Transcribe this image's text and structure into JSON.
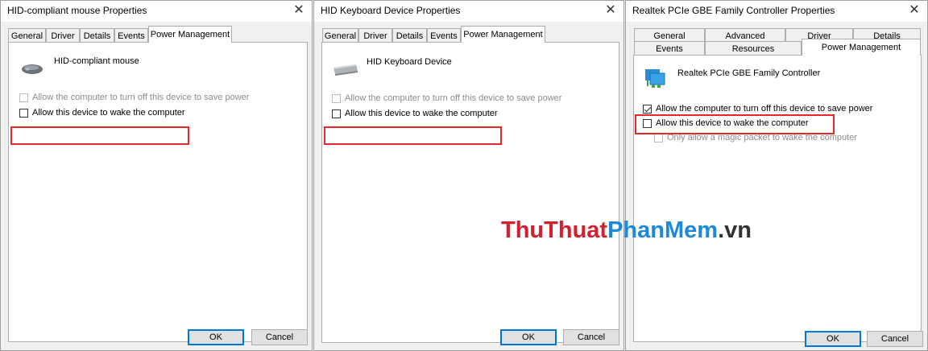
{
  "dialogs": {
    "mouse": {
      "title": "HID-compliant mouse Properties",
      "tabs": [
        "General",
        "Driver",
        "Details",
        "Events",
        "Power Management"
      ],
      "device_name": "HID-compliant mouse",
      "option1": "Allow the computer to turn off this device to save power",
      "option2": "Allow this device to wake the computer",
      "ok": "OK",
      "cancel": "Cancel"
    },
    "keyboard": {
      "title": "HID Keyboard Device Properties",
      "tabs": [
        "General",
        "Driver",
        "Details",
        "Events",
        "Power Management"
      ],
      "device_name": "HID Keyboard Device",
      "option1": "Allow the computer to turn off this device to save power",
      "option2": "Allow this device to wake the computer",
      "ok": "OK",
      "cancel": "Cancel"
    },
    "nic": {
      "title": "Realtek PCIe GBE Family Controller Properties",
      "tabs_row1": [
        "General",
        "Advanced",
        "Driver",
        "Details"
      ],
      "tabs_row2": [
        "Events",
        "Resources",
        "Power Management"
      ],
      "device_name": "Realtek PCIe GBE Family Controller",
      "option1": "Allow the computer to turn off this device to save power",
      "option2": "Allow this device to wake the computer",
      "option3": "Only allow a magic packet to wake the computer",
      "ok": "OK",
      "cancel": "Cancel"
    }
  },
  "close_glyph": "✕",
  "watermark": {
    "part1": "ThuThuat",
    "part2": "PhanMem",
    "part3": ".vn",
    "color1": "#d2202f",
    "color2": "#1e88d9",
    "color3": "#333333"
  },
  "colors": {
    "highlight": "#e8262c",
    "default_button_border": "#0078d7"
  }
}
